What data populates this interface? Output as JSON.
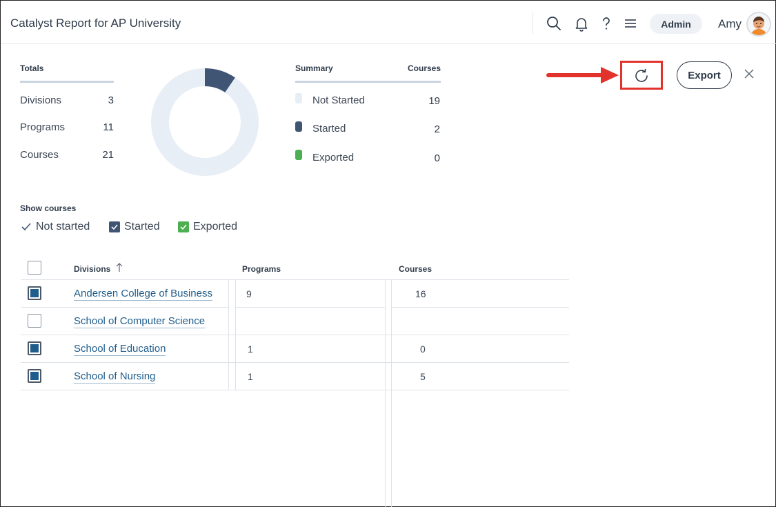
{
  "header": {
    "title": "Catalyst Report for AP University",
    "role_label": "Admin",
    "user_name": "Amy",
    "icons": [
      "search-icon",
      "bell-icon",
      "help-icon",
      "menu-icon"
    ]
  },
  "totals": {
    "label": "Totals",
    "items": [
      {
        "label": "Divisions",
        "value": "3"
      },
      {
        "label": "Programs",
        "value": "11"
      },
      {
        "label": "Courses",
        "value": "21"
      }
    ]
  },
  "summary": {
    "label": "Summary",
    "courses_label": "Courses",
    "items": [
      {
        "label": "Not Started",
        "value": "19",
        "color": "#e8eef6"
      },
      {
        "label": "Started",
        "value": "2",
        "color": "#3f5573"
      },
      {
        "label": "Exported",
        "value": "0",
        "color": "#4caf50"
      }
    ]
  },
  "donut": {
    "slices": [
      {
        "name": "Not Started",
        "value": 19,
        "color": "#e8eef6"
      },
      {
        "name": "Started",
        "value": 2,
        "color": "#3f5573"
      },
      {
        "name": "Exported",
        "value": 0,
        "color": "#4caf50"
      }
    ]
  },
  "toolbar": {
    "export_label": "Export",
    "refresh_icon": "refresh-icon",
    "close_icon": "close-icon",
    "highlight_color": "#e2322c"
  },
  "filters": {
    "label": "Show courses",
    "items": [
      {
        "label": "Not started",
        "checked": true
      },
      {
        "label": "Started",
        "checked": true
      },
      {
        "label": "Exported",
        "checked": true
      }
    ]
  },
  "table": {
    "headers": {
      "divisions": "Divisions",
      "programs": "Programs",
      "courses": "Courses"
    },
    "sort_icon": "arrow-up-icon",
    "rows": [
      {
        "division": "Andersen College of Business",
        "programs": "9",
        "courses": "16",
        "checked": true
      },
      {
        "division": "School of Computer Science",
        "programs": "",
        "courses": "",
        "checked": false
      },
      {
        "division": "School of Education",
        "programs": "1",
        "courses": "0",
        "checked": true
      },
      {
        "division": "School of Nursing",
        "programs": "1",
        "courses": "5",
        "checked": true
      }
    ]
  }
}
